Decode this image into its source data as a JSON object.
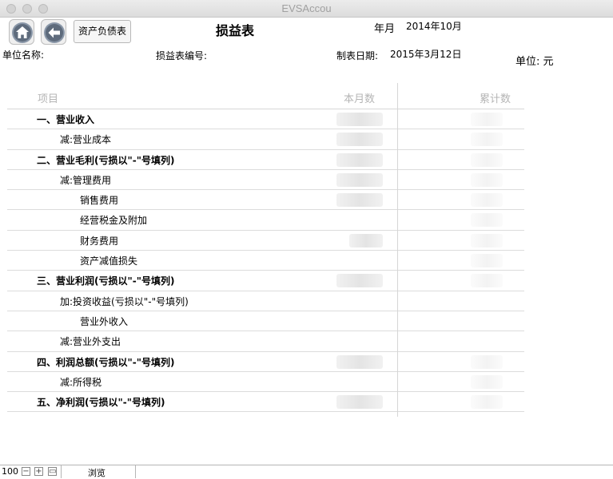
{
  "window": {
    "title": "EVSAccou"
  },
  "toolbar": {
    "home_icon": "home-icon",
    "back_icon": "back-arrow-icon",
    "balance_sheet_label": "资产负债表"
  },
  "report": {
    "title": "损益表",
    "year_month_label": "年月",
    "year_month_value": "2014年10月",
    "unit_name_label": "单位名称:",
    "report_no_label": "损益表编号:",
    "prepared_date_label": "制表日期:",
    "prepared_date_value": "2015年3月12日",
    "currency_unit_label": "单位:  元"
  },
  "table": {
    "headers": [
      "项目",
      "本月数",
      "累计数"
    ],
    "rows": [
      {
        "label": "一、营业收入"
      },
      {
        "label": "减:营业成本"
      },
      {
        "label": "二、营业毛利(亏损以\"-\"号填列)"
      },
      {
        "label": "减:管理费用"
      },
      {
        "label": "销售费用"
      },
      {
        "label": "经营税金及附加"
      },
      {
        "label": "财务费用"
      },
      {
        "label": "资产减值损失"
      },
      {
        "label": "三、营业利润(亏损以\"-\"号填列)"
      },
      {
        "label": "加:投资收益(亏损以\"-\"号填列)"
      },
      {
        "label": "营业外收入"
      },
      {
        "label": "减:营业外支出"
      },
      {
        "label": "四、利润总额(亏损以\"-\"号填列)"
      },
      {
        "label": "减:所得税"
      },
      {
        "label": "五、净利润(亏损以\"-\"号填列)"
      }
    ]
  },
  "statusbar": {
    "zoom": "100",
    "minus_icon": "zoom-out-icon",
    "plus_icon": "zoom-in-icon",
    "layout_icon": "layout-toggle-icon",
    "mode": "浏览"
  }
}
